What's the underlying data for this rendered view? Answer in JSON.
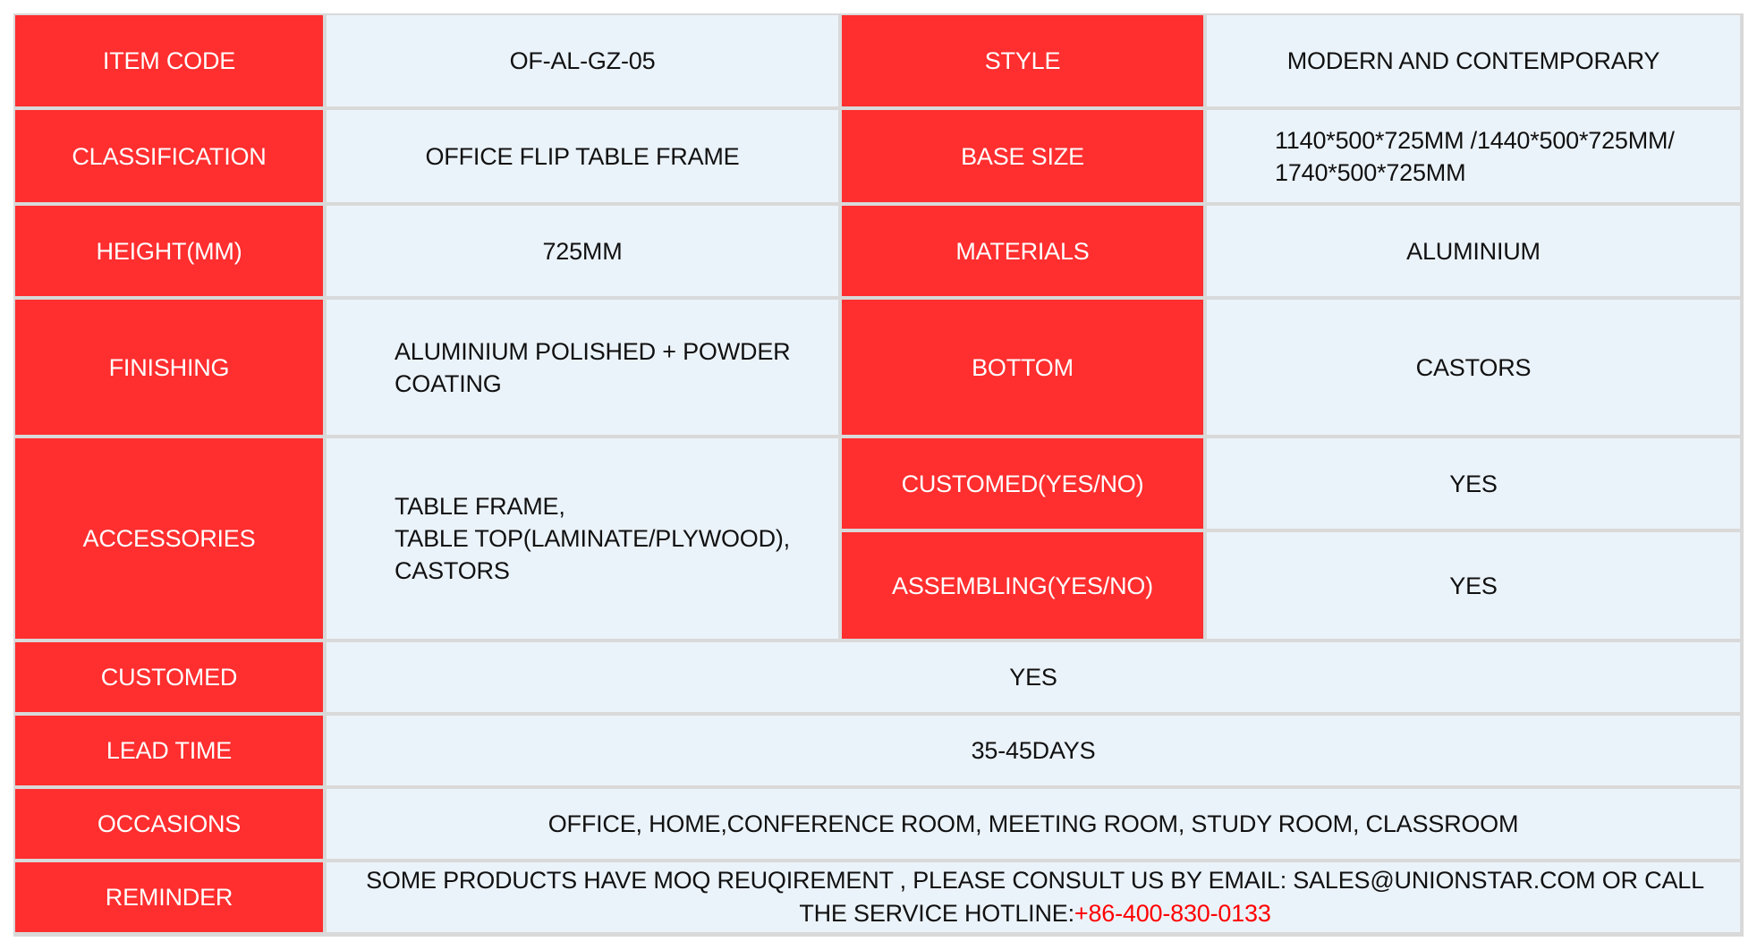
{
  "colors": {
    "label_background": "#ff2e2f",
    "value_background": "#ebf3fa",
    "gridline": "#d9d9d9",
    "hotline_text": "#ff0000"
  },
  "spec": {
    "item_code": {
      "label": "ITEM CODE",
      "value": "OF-AL-GZ-05"
    },
    "style": {
      "label": "STYLE",
      "value": "MODERN AND CONTEMPORARY"
    },
    "classification": {
      "label": "CLASSIFICATION",
      "value": "OFFICE FLIP TABLE FRAME"
    },
    "base_size": {
      "label": "BASE SIZE",
      "lines": [
        "1140*500*725MM /1440*500*725MM/",
        "1740*500*725MM"
      ]
    },
    "height": {
      "label": "HEIGHT(MM)",
      "value": "725MM"
    },
    "materials": {
      "label": "MATERIALS",
      "value": "ALUMINIUM"
    },
    "finishing": {
      "label": "FINISHING",
      "lines": [
        "ALUMINIUM POLISHED + POWDER",
        "COATING"
      ]
    },
    "bottom": {
      "label": "BOTTOM",
      "value": "CASTORS"
    },
    "accessories": {
      "label": "ACCESSORIES",
      "lines": [
        "TABLE FRAME,",
        "TABLE TOP(LAMINATE/PLYWOOD),",
        "CASTORS"
      ]
    },
    "customed_yes_no": {
      "label": "CUSTOMED(YES/NO)",
      "value": "YES"
    },
    "assembling_yes_no": {
      "label": "ASSEMBLING(YES/NO)",
      "value": "YES"
    },
    "customed": {
      "label": "CUSTOMED",
      "value": "YES"
    },
    "lead_time": {
      "label": "LEAD TIME",
      "value": "35-45DAYS"
    },
    "occasions": {
      "label": "OCCASIONS",
      "value": "OFFICE, HOME,CONFERENCE ROOM, MEETING ROOM, STUDY ROOM, CLASSROOM"
    },
    "reminder": {
      "label": "REMINDER",
      "text": "SOME PRODUCTS HAVE MOQ REUQIREMENT , PLEASE CONSULT US BY EMAIL: SALES@UNIONSTAR.COM OR CALL THE SERVICE HOTLINE:",
      "hotline": "+86-400-830-0133"
    }
  }
}
